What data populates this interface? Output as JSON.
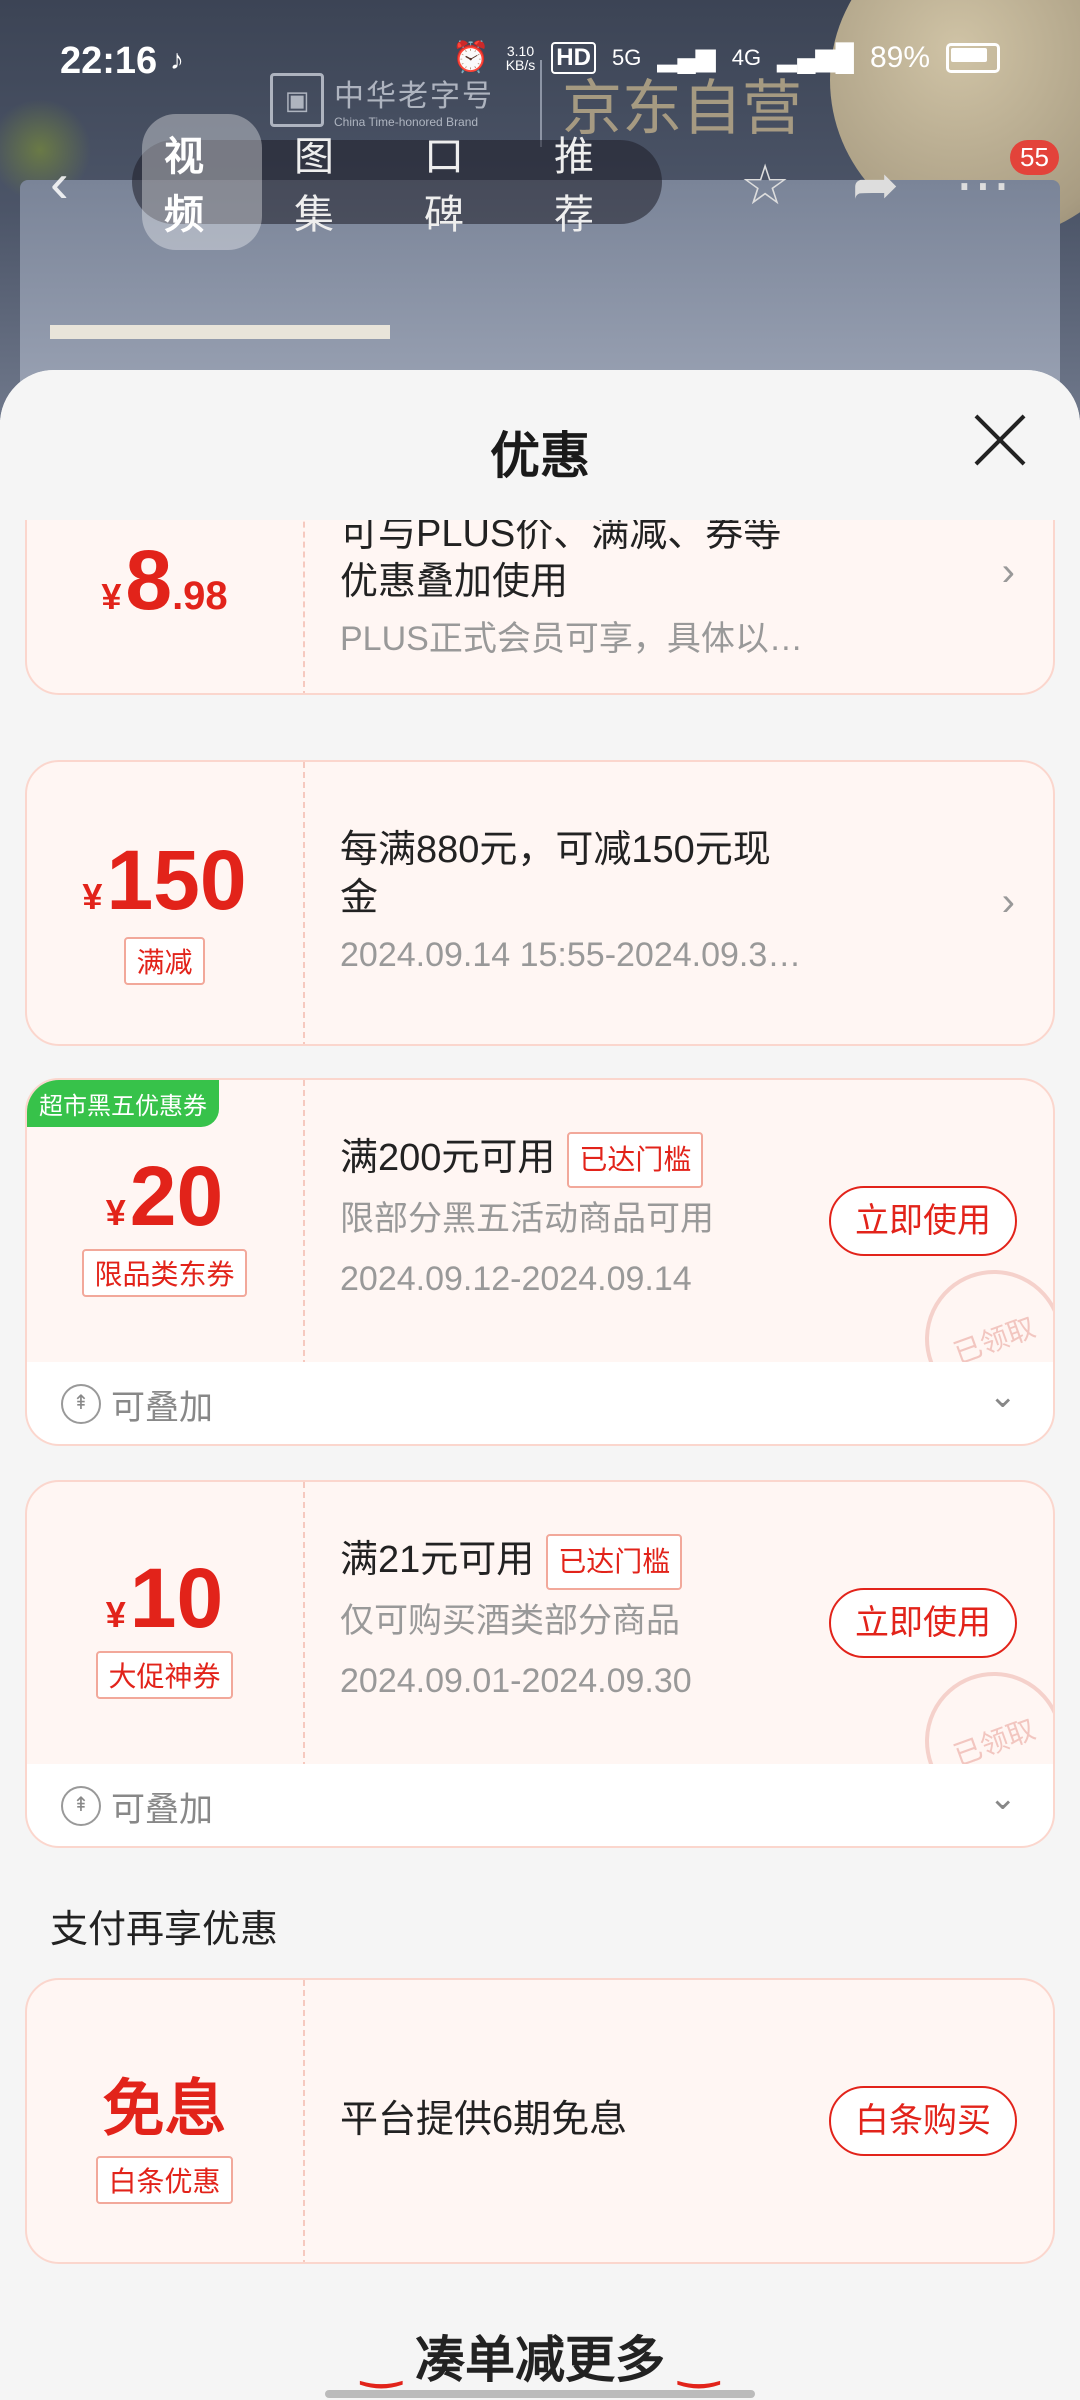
{
  "status": {
    "time": "22:16",
    "net_speed": "3.10\nKB/s",
    "net_speed_top": "3.10",
    "net_speed_bottom": "KB/s",
    "hd": "HD",
    "sig1": "5G",
    "sig2": "4G",
    "battery": "89%"
  },
  "background": {
    "brand_cn": "中华老字号",
    "brand_en": "China Time-honored Brand",
    "self_operated": "京东自营"
  },
  "nav": {
    "tabs": [
      "视频",
      "图集",
      "口碑",
      "推荐"
    ],
    "badge": "55"
  },
  "sheet": {
    "title": "优惠"
  },
  "coupons": [
    {
      "yen": "¥",
      "amount_int": "8",
      "amount_dec": ".98",
      "title": "可与PLUS价、满减、券等",
      "title2": "优惠叠加使用",
      "sub": "PLUS正式会员可享，具体以…"
    },
    {
      "yen": "¥",
      "amount_int": "150",
      "tag": "满减",
      "title": "每满880元，可减150元现",
      "title2": "金",
      "sub": "2024.09.14 15:55-2024.09.3…"
    },
    {
      "corner": "超市黑五优惠券",
      "yen": "¥",
      "amount_int": "20",
      "tag": "限品类东券",
      "title": "满200元可用",
      "reach": "已达门槛",
      "sub": "限部分黑五活动商品可用",
      "date": "2024.09.12-2024.09.14",
      "button": "立即使用",
      "stamp": "已领取",
      "stack": "可叠加"
    },
    {
      "yen": "¥",
      "amount_int": "10",
      "tag": "大促神券",
      "title": "满21元可用",
      "reach": "已达门槛",
      "sub": "仅可购买酒类部分商品",
      "date": "2024.09.01-2024.09.30",
      "button": "立即使用",
      "stamp": "已领取",
      "stack": "可叠加"
    }
  ],
  "payment": {
    "section_title": "支付再享优惠",
    "amount": "免息",
    "tag": "白条优惠",
    "title": "平台提供6期免息",
    "button": "白条购买"
  },
  "more": {
    "label": "凑单减更多"
  },
  "colors": {
    "accent": "#e2231a",
    "card_bg": "#fff6f3",
    "card_border": "#fbd6cd",
    "green_tag": "#37c24a"
  }
}
